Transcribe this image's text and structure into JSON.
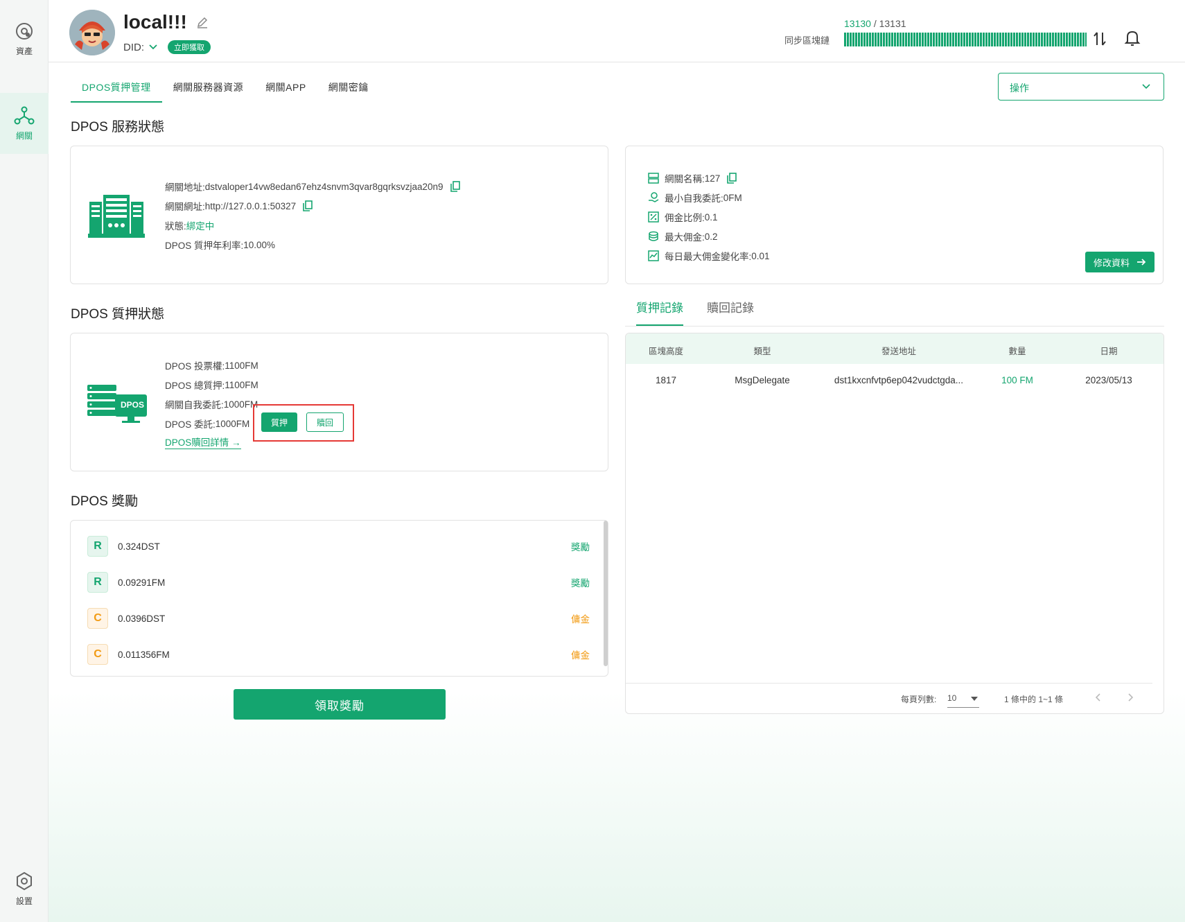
{
  "sidebar": {
    "items": [
      {
        "label": "資產",
        "icon": "asset-icon"
      },
      {
        "label": "網關",
        "icon": "gateway-icon",
        "active": true
      },
      {
        "label": "設置",
        "icon": "settings-icon"
      }
    ]
  },
  "header": {
    "title": "local!!!",
    "did_label": "DID:",
    "did_badge": "立即獲取",
    "sync_label": "同步區塊鏈",
    "sync_current": "13130",
    "sync_sep": " / ",
    "sync_total": "13131"
  },
  "tabs": [
    {
      "label": "DPOS質押管理",
      "active": true
    },
    {
      "label": "網關服務器資源"
    },
    {
      "label": "網關APP"
    },
    {
      "label": "網關密鑰"
    }
  ],
  "operation_select": {
    "value": "操作"
  },
  "service_status": {
    "title": "DPOS 服務狀態",
    "address_label": "網關地址: ",
    "address": "dstvaloper14vw8edan67ehz4snvm3qvar8gqrksvzjaa20n9",
    "url_label": "網關網址: ",
    "url": "http://127.0.0.1:50327",
    "status_label": "狀態: ",
    "status": "綁定中",
    "rate_label": "DPOS 質押年利率: ",
    "rate": "10.00%"
  },
  "gateway_info": {
    "name_label": "網關名稱: ",
    "name": "127",
    "min_self_label": "最小自我委託: ",
    "min_self": "0FM",
    "commission_label": "佣金比例: ",
    "commission": "0.1",
    "max_commission_label": "最大佣金: ",
    "max_commission": "0.2",
    "max_change_label": "每日最大佣金變化率: ",
    "max_change": "0.01",
    "edit_button": "修改資料"
  },
  "stake_status": {
    "title": "DPOS 質押狀態",
    "votes_label": "DPOS 投票權: ",
    "votes": "1100FM",
    "total_label": "DPOS 總質押: ",
    "total": "1100FM",
    "self_label": "網關自我委託: ",
    "self": "1000FM",
    "delegate_label": "DPOS 委託: ",
    "delegate": "1000FM",
    "stake_button": "質押",
    "redeem_button": "贖回",
    "detail_link": "DPOS贖回詳情",
    "dpos_badge": "DPOS"
  },
  "records": {
    "tabs": [
      {
        "label": "質押記錄",
        "active": true
      },
      {
        "label": "贖回記錄"
      }
    ],
    "columns": [
      "區塊高度",
      "類型",
      "發送地址",
      "數量",
      "日期"
    ],
    "rows": [
      {
        "height": "1817",
        "type": "MsgDelegate",
        "from": "dst1kxcnfvtp6ep042vudctgda...",
        "amount": "100 FM",
        "date": "2023/05/13"
      }
    ],
    "pager": {
      "rows_per_page_label": "每頁列數:",
      "rows_per_page": "10",
      "range": "1 條中的 1~1 條"
    }
  },
  "rewards": {
    "title": "DPOS 獎勵",
    "items": [
      {
        "letter": "R",
        "amount": "0.324DST",
        "type": "獎勵",
        "kind": "r"
      },
      {
        "letter": "R",
        "amount": "0.09291FM",
        "type": "獎勵",
        "kind": "r"
      },
      {
        "letter": "C",
        "amount": "0.0396DST",
        "type": "傭金",
        "kind": "c"
      },
      {
        "letter": "C",
        "amount": "0.011356FM",
        "type": "傭金",
        "kind": "c"
      }
    ],
    "claim_button": "領取獎勵"
  },
  "colors": {
    "accent": "#14a56f",
    "commission": "#f29b14",
    "highlight": "#e53935"
  }
}
